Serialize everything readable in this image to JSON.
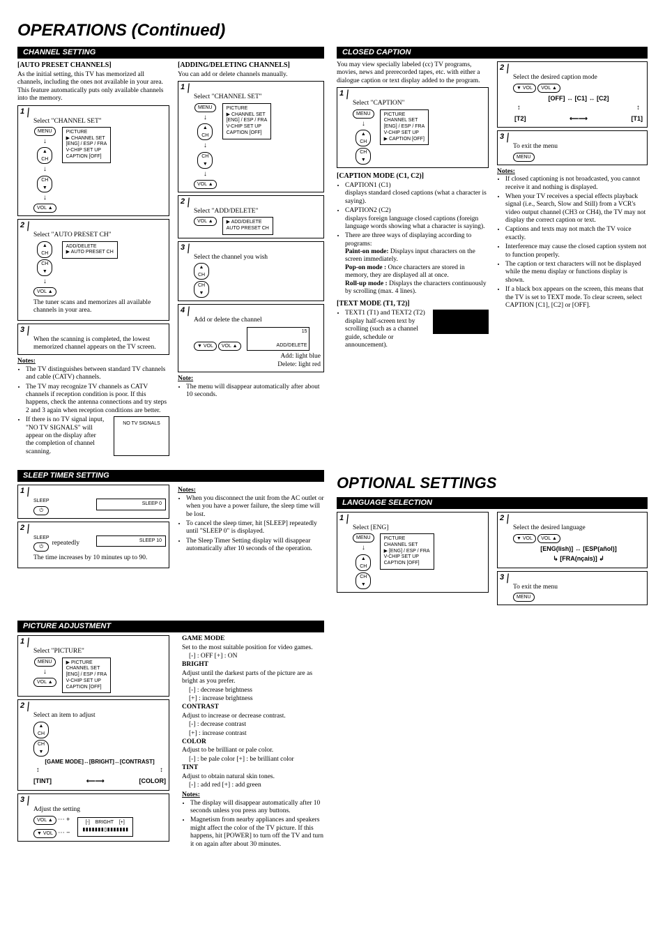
{
  "page_title": "OPERATIONS (Continued)",
  "channel_setting": {
    "bar": "CHANNEL SETTING",
    "auto": {
      "heading": "[AUTO PRESET CHANNELS]",
      "intro": "As the initial setting, this TV has memorized all channels, including the ones not available in your area. This feature automatically puts only available channels into the memory.",
      "step1": "Select \"CHANNEL SET\"",
      "menu1": "PICTURE\n▶ CHANNEL SET\n[ENG] / ESP / FRA\nV-CHIP SET UP\nCAPTION [OFF]",
      "step2": "Select \"AUTO PRESET CH\"",
      "menu2": "ADD/DELETE\n▶ AUTO PRESET CH",
      "scan_text": "The tuner scans and memorizes all available channels in your area.",
      "step3": "When the scanning is completed, the lowest memorized channel appears on the TV screen.",
      "notes_title": "Notes:",
      "note1": "The TV distinguishes between standard TV channels and cable (CATV) channels.",
      "note2": "The TV may recognize TV channels as CATV channels if reception condition is poor. If this happens, check the antenna connections and try steps 2 and 3 again when reception conditions are better.",
      "note3": "If there is no TV signal input, \"NO TV SIGNALS\" will appear on the display after the completion of channel scanning.",
      "no_signal": "NO TV SIGNALS"
    },
    "adddel": {
      "heading": "[ADDING/DELETING CHANNELS]",
      "intro": "You can add or delete channels manually.",
      "step1": "Select \"CHANNEL SET\"",
      "menu1": "PICTURE\n▶ CHANNEL SET\n[ENG] / ESP / FRA\nV-CHIP SET UP\nCAPTION [OFF]",
      "step2": "Select \"ADD/DELETE\"",
      "menu2": "▶ ADD/DELETE\nAUTO PRESET CH",
      "step3": "Select the channel you wish",
      "step4": "Add or delete the channel",
      "box4a": "15",
      "box4b": "ADD/DELETE",
      "legend_add": "Add: light blue",
      "legend_del": "Delete: light red",
      "note_title": "Note:",
      "note": "The menu will disappear automatically after about 10 seconds."
    }
  },
  "closed_caption": {
    "bar": "CLOSED CAPTION",
    "intro": "You may view specially labeled (cc) TV programs, movies, news and prerecorded tapes, etc. with either a dialogue caption or text display added to the program.",
    "step1": "Select \"CAPTION\"",
    "menu1": "PICTURE\nCHANNEL SET\n[ENG] / ESP / FRA\nV-CHIP SET UP\n▶ CAPTION [OFF]",
    "cap_mode_heading": "[CAPTION MODE (C1, C2)]",
    "cap1": "CAPTION1 (C1)",
    "cap1_desc": "displays standard closed captions (what a character is saying).",
    "cap2": "CAPTION2 (C2)",
    "cap2_desc": "displays foreign language closed captions (foreign language words showing what a character is saying).",
    "three_ways": "There are three ways of displaying according to programs:",
    "paint_label": "Paint-on mode:",
    "paint_desc": "Displays input characters on the screen immediately.",
    "pop_label": "Pop-on mode :",
    "pop_desc": "Once characters are stored in memory, they are displayed all at once.",
    "roll_label": "Roll-up mode :",
    "roll_desc": "Displays the characters continuously by scrolling (max. 4 lines).",
    "text_heading": "[TEXT MODE (T1, T2)]",
    "text_desc": "TEXT1 (T1) and TEXT2 (T2) display half-screen text by scrolling (such as a channel guide, schedule or announcement).",
    "step2": "Select the desired caption mode",
    "modes_line": "[OFF]   ↔   [C1]   ↔   [C2]",
    "t2": "[T2]",
    "t1": "[T1]",
    "step3": "To exit the menu",
    "notes_title": "Notes:",
    "n1": "If closed captioning is not broadcasted, you cannot receive it and nothing is displayed.",
    "n2": "When your TV receives a special effects playback signal (i.e., Search, Slow and Still) from a VCR's video output channel (CH3 or CH4), the TV may not display the correct caption or text.",
    "n3": "Captions and texts may not match the TV voice exactly.",
    "n4": "Interference may cause the closed caption system not to function properly.",
    "n5": "The caption or text characters will not be displayed while the menu display or functions display is shown.",
    "n6": "If a black box appears on the screen, this means that the TV is set to TEXT mode. To clear screen, select CAPTION [C1], [C2] or [OFF]."
  },
  "sleep": {
    "bar": "SLEEP TIMER SETTING",
    "sleep_label": "SLEEP",
    "box1": "SLEEP 0",
    "rep": "repeatedly",
    "box2": "SLEEP 10",
    "desc": "The time increases by 10 minutes up to 90.",
    "notes_title": "Notes:",
    "n1": "When you disconnect the unit from the AC outlet or when you have a power failure, the sleep time will be lost.",
    "n2": "To cancel the sleep timer, hit [SLEEP] repeatedly until \"SLEEP 0\" is displayed.",
    "n3": "The Sleep Timer Setting display will disappear automatically after 10 seconds of the operation."
  },
  "optional": {
    "title": "OPTIONAL SETTINGS",
    "bar": "LANGUAGE SELECTION",
    "step1": "Select [ENG]",
    "menu1": "PICTURE\nCHANNEL SET\n▶ [ENG] / ESP / FRA\nV-CHIP SET UP\nCAPTION [OFF]",
    "step2": "Select the desired language",
    "langs": "[ENG(lish)]  ↔  [ESP(añol)]",
    "lang_fra": "[FRA(nçais)]",
    "step3": "To exit the menu"
  },
  "picture": {
    "bar": "PICTURE ADJUSTMENT",
    "step1": "Select \"PICTURE\"",
    "menu1": "▶ PICTURE\nCHANNEL SET\n[ENG] / ESP / FRA\nV-CHIP SET UP\nCAPTION [OFF]",
    "step2": "Select an item to adjust",
    "row": "[GAME MODE]↔[BRIGHT]↔[CONTRAST]",
    "tint": "[TINT]",
    "color": "[COLOR]",
    "step3": "Adjust the setting",
    "adjust_label": "BRIGHT",
    "adjust_bar": "▮▮▮▮▮▮▮▯▮▮▮▮▮▮▮",
    "plus": "+",
    "minus": "−",
    "game_h": "GAME MODE",
    "game_d": "Set to the most suitable position for video games.",
    "game_vals": "[-] : OFF                  [+] : ON",
    "bright_h": "BRIGHT",
    "bright_d": "Adjust until the darkest parts of the picture are as bright as you prefer.",
    "bright_m": "[-] : decrease brightness",
    "bright_p": "[+] : increase brightness",
    "contrast_h": "CONTRAST",
    "contrast_d": "Adjust to increase or decrease contrast.",
    "contrast_m": "[-] : decrease contrast",
    "contrast_p": "[+] : increase contrast",
    "color_h": "COLOR",
    "color_d": "Adjust to be brilliant or pale color.",
    "color_vals": "[-] : be pale color       [+] : be brilliant color",
    "tint_h": "TINT",
    "tint_d": "Adjust to obtain natural skin tones.",
    "tint_vals": "[-] : add red                  [+] : add green",
    "notes_title": "Notes:",
    "n1": "The display will disappear automatically after 10 seconds unless you press any buttons.",
    "n2": "Magnetism from nearby appliances and speakers might affect the color of the TV picture. If this happens, hit [POWER] to turn off the TV and turn it on again after about 30 minutes."
  },
  "buttons": {
    "menu": "MENU",
    "ch_up": "▲\nCH",
    "ch_dn": "CH\n▼",
    "vol_up": "VOL ▲",
    "vol_dn": "▼ VOL"
  }
}
